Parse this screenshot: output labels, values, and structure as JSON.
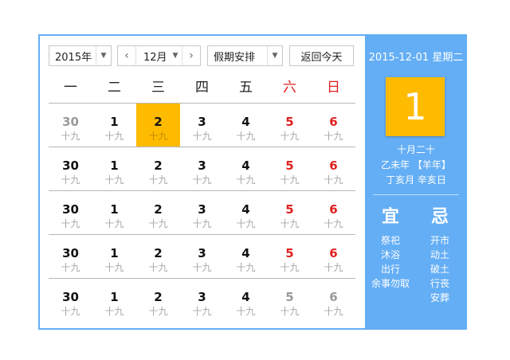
{
  "toolbar": {
    "year": "2015年",
    "month": "12月",
    "holiday": "假期安排",
    "today_label": "返回今天"
  },
  "weekdays": [
    "一",
    "二",
    "三",
    "四",
    "五",
    "六",
    "日"
  ],
  "weeks": [
    [
      {
        "num": "30",
        "lunar": "十九",
        "other": true
      },
      {
        "num": "1",
        "lunar": "十九"
      },
      {
        "num": "2",
        "lunar": "十九",
        "selected": true
      },
      {
        "num": "3",
        "lunar": "十九"
      },
      {
        "num": "4",
        "lunar": "十九"
      },
      {
        "num": "5",
        "lunar": "十九",
        "weekend": true
      },
      {
        "num": "6",
        "lunar": "十九",
        "weekend": true
      }
    ],
    [
      {
        "num": "30",
        "lunar": "十九"
      },
      {
        "num": "1",
        "lunar": "十九"
      },
      {
        "num": "2",
        "lunar": "十九"
      },
      {
        "num": "3",
        "lunar": "十九"
      },
      {
        "num": "4",
        "lunar": "十九"
      },
      {
        "num": "5",
        "lunar": "十九",
        "weekend": true
      },
      {
        "num": "6",
        "lunar": "十九",
        "weekend": true
      }
    ],
    [
      {
        "num": "30",
        "lunar": "十九"
      },
      {
        "num": "1",
        "lunar": "十九"
      },
      {
        "num": "2",
        "lunar": "十九"
      },
      {
        "num": "3",
        "lunar": "十九"
      },
      {
        "num": "4",
        "lunar": "十九"
      },
      {
        "num": "5",
        "lunar": "十九",
        "weekend": true
      },
      {
        "num": "6",
        "lunar": "十九",
        "weekend": true
      }
    ],
    [
      {
        "num": "30",
        "lunar": "十九"
      },
      {
        "num": "1",
        "lunar": "十九"
      },
      {
        "num": "2",
        "lunar": "十九"
      },
      {
        "num": "3",
        "lunar": "十九"
      },
      {
        "num": "4",
        "lunar": "十九"
      },
      {
        "num": "5",
        "lunar": "十九",
        "weekend": true
      },
      {
        "num": "6",
        "lunar": "十九",
        "weekend": true
      }
    ],
    [
      {
        "num": "30",
        "lunar": "十九"
      },
      {
        "num": "1",
        "lunar": "十九"
      },
      {
        "num": "2",
        "lunar": "十九"
      },
      {
        "num": "3",
        "lunar": "十九"
      },
      {
        "num": "4",
        "lunar": "十九"
      },
      {
        "num": "5",
        "lunar": "十九",
        "other": true
      },
      {
        "num": "6",
        "lunar": "十九",
        "other": true
      }
    ]
  ],
  "detail": {
    "date_text": "2015-12-01 星期二",
    "big_day": "1",
    "lunar_md": "十月二十",
    "ganzhi_year": "乙未年 【羊年】",
    "ganzhi_mday": "丁亥月 辛亥日",
    "yi_label": "宜",
    "ji_label": "忌",
    "yi_items": [
      "祭祀",
      "沐浴",
      "出行",
      "余事勿取"
    ],
    "ji_items": [
      "开市",
      "动土",
      "破土",
      "行丧",
      "安葬"
    ]
  },
  "colors": {
    "accent": "#64aef5",
    "selected": "#ffbb00",
    "weekend": "#e02020"
  }
}
